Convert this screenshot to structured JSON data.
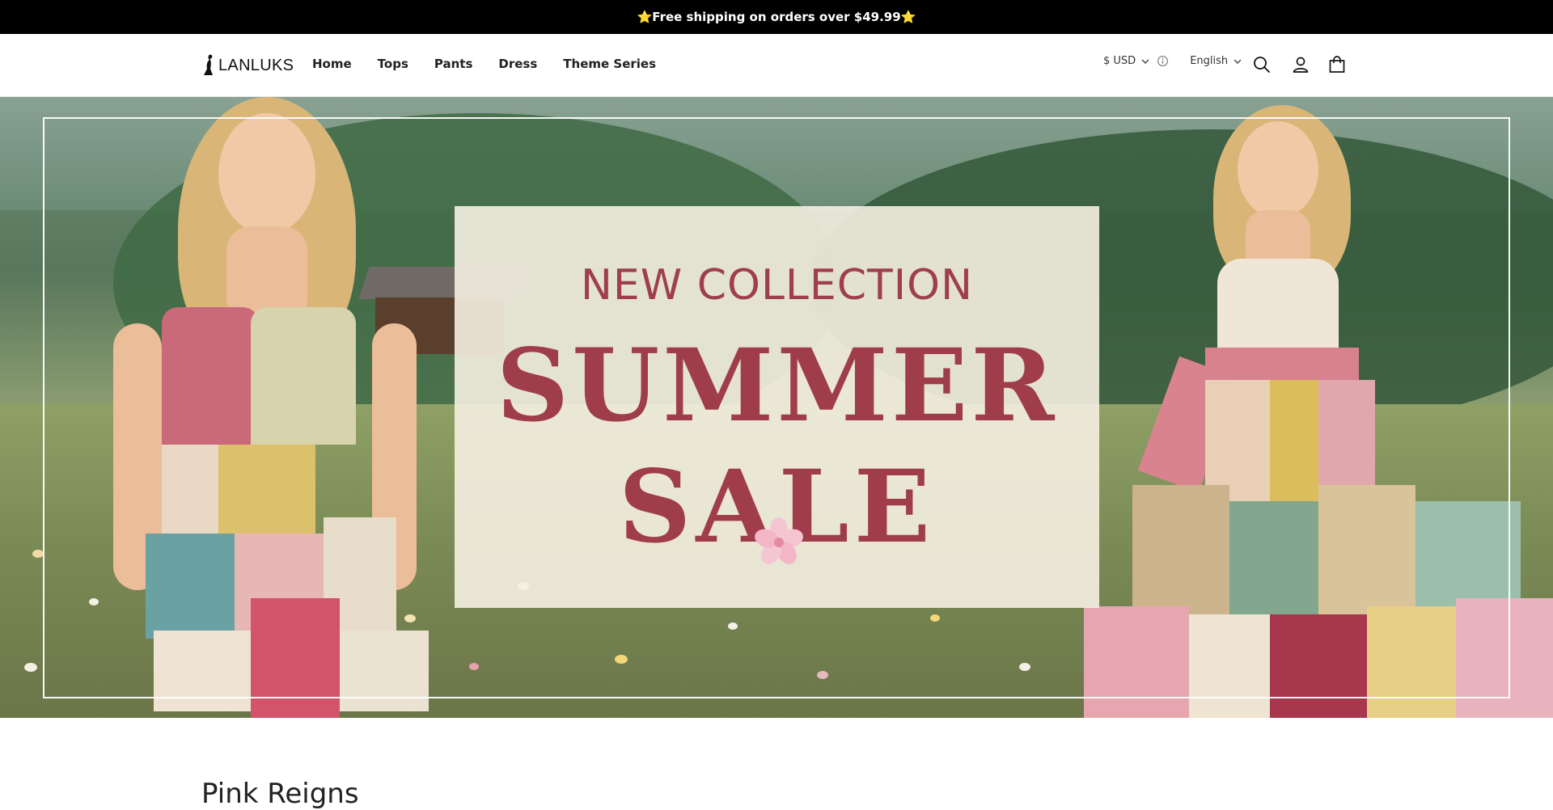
{
  "announcement": {
    "text": "⭐Free shipping on orders over $49.99⭐"
  },
  "header": {
    "logo_text": "LANLUKS",
    "nav": [
      {
        "label": "Home"
      },
      {
        "label": "Tops"
      },
      {
        "label": "Pants"
      },
      {
        "label": "Dress"
      },
      {
        "label": "Theme Series"
      }
    ],
    "currency": "$ USD",
    "language": "English",
    "icons": [
      "search-icon",
      "account-icon",
      "cart-icon",
      "chevron-down-icon",
      "info-icon"
    ]
  },
  "hero": {
    "subtitle": "NEW COLLECTION",
    "headline_line1": "SUMMER",
    "headline_line2": "SALE",
    "text_color": "#a03d4a"
  },
  "section": {
    "title": "Pink Reigns"
  },
  "colors": {
    "announcement_bg": "#000000",
    "accent": "#a03d4a",
    "panel_bg": "#f5f0e2"
  }
}
